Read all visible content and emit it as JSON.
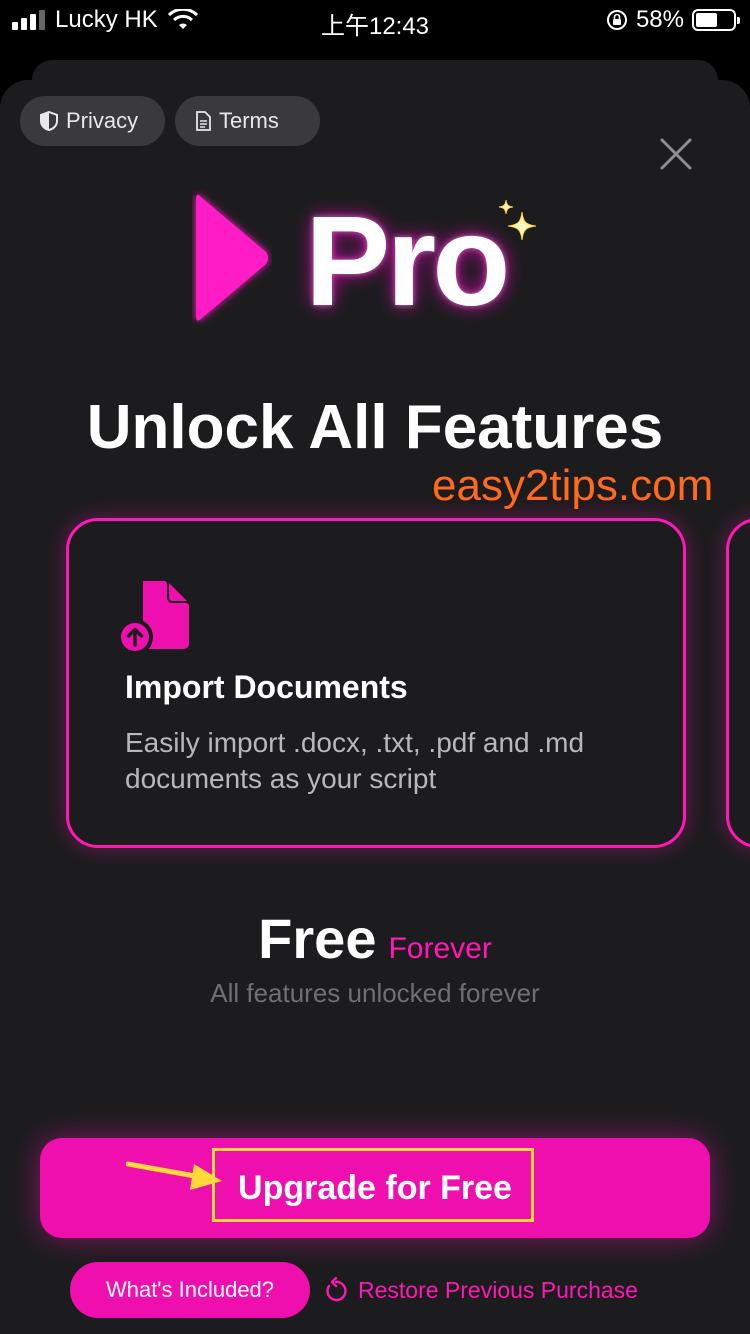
{
  "status_bar": {
    "carrier": "Lucky HK",
    "time": "上午12:43",
    "battery": "58%",
    "battery_level": 0.58
  },
  "header": {
    "privacy_label": "Privacy",
    "terms_label": "Terms"
  },
  "logo": {
    "text": "Pro"
  },
  "headline": "Unlock All Features",
  "watermark": "easy2tips.com",
  "feature": {
    "title": "Import Documents",
    "description": "Easily import .docx, .txt, .pdf and .md documents as your script"
  },
  "pricing": {
    "price": "Free",
    "period": "Forever",
    "subtitle": "All features unlocked forever"
  },
  "cta": {
    "label": "Upgrade for Free"
  },
  "footer": {
    "included_label": "What's Included?",
    "restore_label": "Restore Previous Purchase"
  },
  "colors": {
    "accent": "#ee0fae",
    "accent_border": "#ff19b4",
    "background": "#1c1c1e",
    "watermark": "#ff6a1f",
    "highlight": "#ffd83a"
  }
}
